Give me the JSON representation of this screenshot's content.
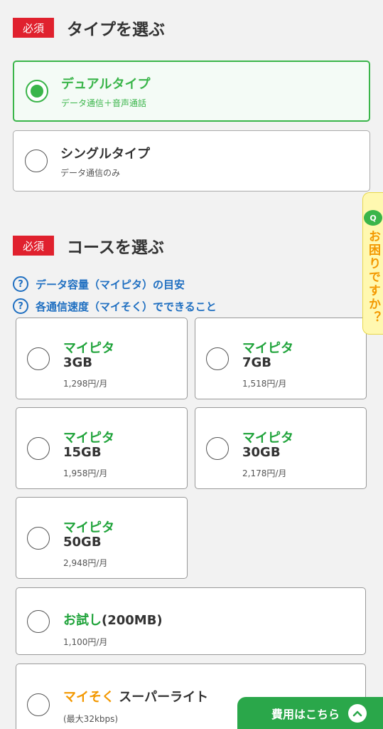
{
  "type_section": {
    "badge": "必須",
    "title": "タイプを選ぶ",
    "options": [
      {
        "name": "デュアルタイプ",
        "sub": "データ通信＋音声通話",
        "selected": true
      },
      {
        "name": "シングルタイプ",
        "sub": "データ通信のみ",
        "selected": false
      }
    ]
  },
  "course_section": {
    "badge": "必須",
    "title": "コースを選ぶ",
    "help_links": [
      "データ容量（マイピタ）の目安",
      "各通信速度（マイそく）でできること"
    ],
    "help_icon": "?",
    "plans": [
      {
        "brand": "マイピタ",
        "size": "3GB",
        "price": "1,298円/月"
      },
      {
        "brand": "マイピタ",
        "size": "7GB",
        "price": "1,518円/月"
      },
      {
        "brand": "マイピタ",
        "size": "15GB",
        "price": "1,958円/月"
      },
      {
        "brand": "マイピタ",
        "size": "30GB",
        "price": "2,178円/月"
      },
      {
        "brand": "マイピタ",
        "size": "50GB",
        "price": "2,948円/月"
      }
    ],
    "trial": {
      "brand": "お試し",
      "size": "(200MB)",
      "price": "1,100円/月"
    },
    "maisoku": {
      "brand": "マイそく",
      "name": "スーパーライト",
      "note": "(最大32kbps)"
    }
  },
  "help_tab": {
    "q_label": "Q",
    "text": "お困りですか？"
  },
  "cost_bar": {
    "label": "費用はこちら"
  },
  "colors": {
    "accent": "#3ab54a",
    "brand_green": "#1fa33a",
    "required_red": "#e0212e",
    "link_blue": "#1f6fc1",
    "orange": "#f39800"
  }
}
